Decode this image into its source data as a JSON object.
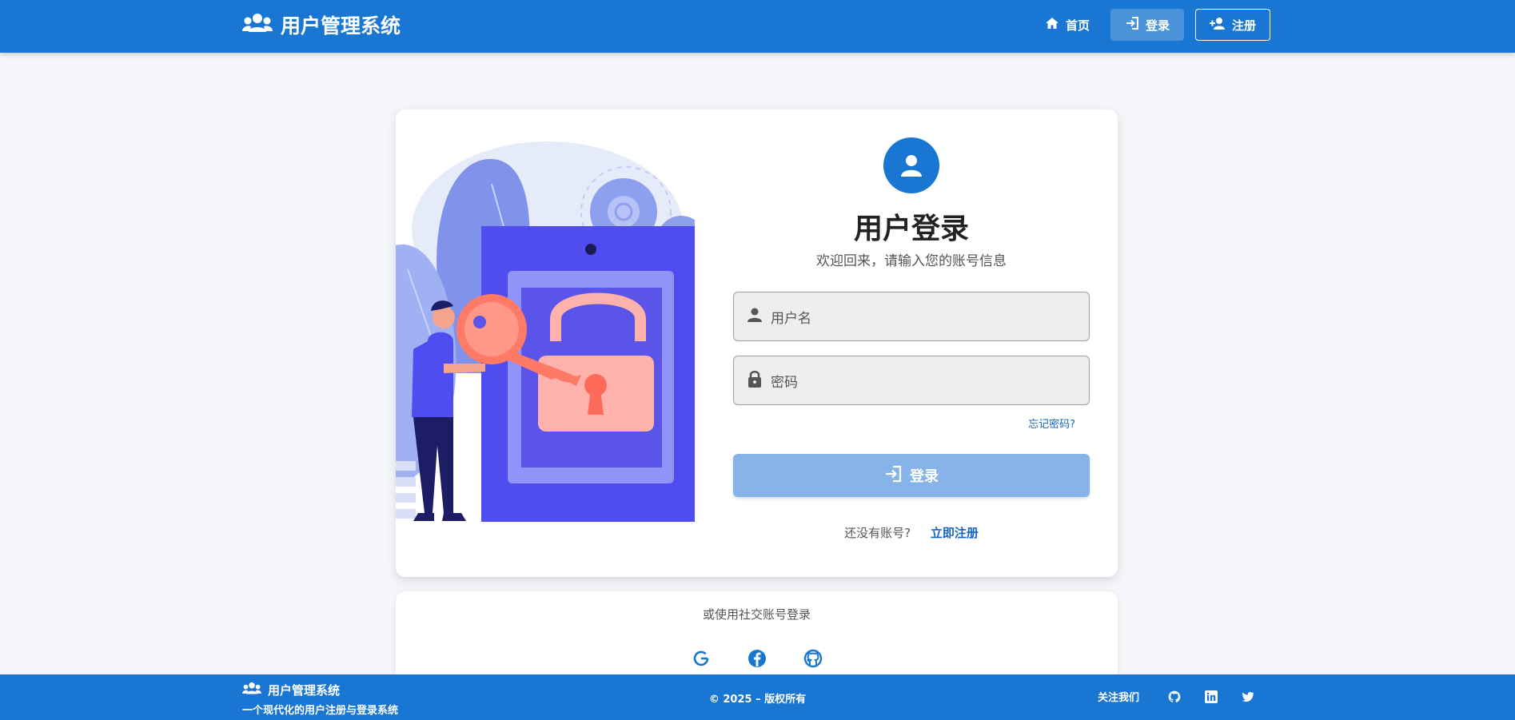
{
  "header": {
    "brand": "用户管理系统",
    "nav": {
      "home": "首页",
      "login": "登录",
      "register": "注册"
    }
  },
  "login_card": {
    "title": "用户登录",
    "subtitle": "欢迎回来，请输入您的账号信息",
    "username_placeholder": "用户名",
    "password_placeholder": "密码",
    "forgot": "忘记密码?",
    "submit": "登录",
    "no_account": "还没有账号?",
    "register_link": "立即注册"
  },
  "social": {
    "label": "或使用社交账号登录",
    "icons": [
      "google-icon",
      "facebook-icon",
      "github-icon"
    ]
  },
  "footer": {
    "brand": "用户管理系统",
    "tagline": "一个现代化的用户注册与登录系统",
    "copyright": "©  2025 – 版权所有",
    "follow": "关注我们",
    "icons": [
      "github-icon",
      "linkedin-icon",
      "twitter-icon"
    ]
  },
  "colors": {
    "primary": "#1976d2",
    "button_disabled": "#86b4e8",
    "link": "#1565c0"
  }
}
